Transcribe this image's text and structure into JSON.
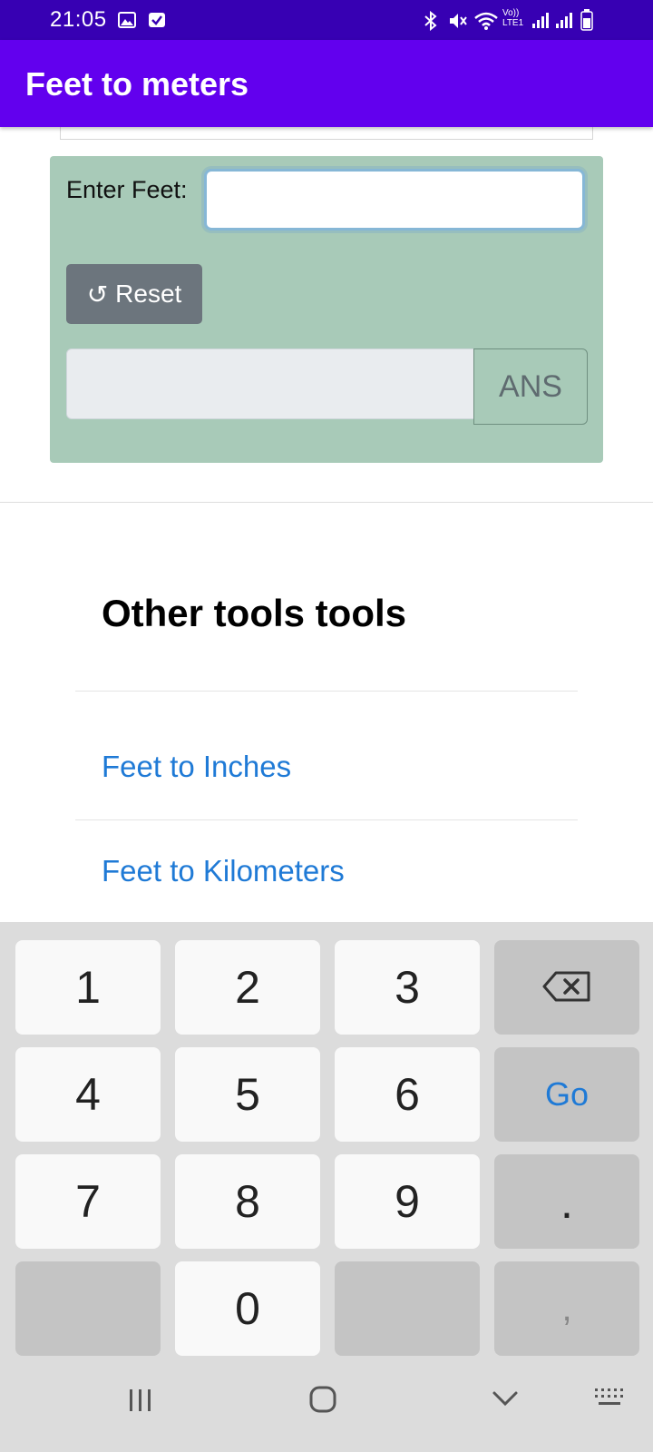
{
  "status_bar": {
    "time": "21:05",
    "icons": [
      "image-icon",
      "check-box-icon",
      "bluetooth-icon",
      "mute-icon",
      "wifi-icon",
      "volte-icon",
      "signal-icon",
      "signal-icon",
      "battery-icon"
    ],
    "volte_label": "Vo)) LTE1"
  },
  "app_bar": {
    "title": "Feet to meters"
  },
  "converter": {
    "enter_label": "Enter Feet:",
    "feet_value": "",
    "reset_icon": "↺",
    "reset_label": "Reset",
    "result_value": "",
    "ans_label": "ANS"
  },
  "other_tools": {
    "title": "Other tools tools",
    "links": [
      "Feet to Inches",
      "Feet to Kilometers"
    ]
  },
  "keyboard": {
    "keys": [
      "1",
      "2",
      "3",
      "backspace",
      "4",
      "5",
      "6",
      "Go",
      "7",
      "8",
      "9",
      ".",
      "",
      "0",
      "",
      ","
    ],
    "go_color": "#1f7ad6"
  },
  "nav_bar": {
    "icons": [
      "recent-apps-icon",
      "home-icon",
      "back-icon",
      "keyboard-icon"
    ]
  },
  "colors": {
    "status_bar": "#3700b3",
    "app_bar": "#6200ee",
    "card_bg": "#a8cab8",
    "reset_button": "#6c757d",
    "link": "#1f7ad6"
  }
}
